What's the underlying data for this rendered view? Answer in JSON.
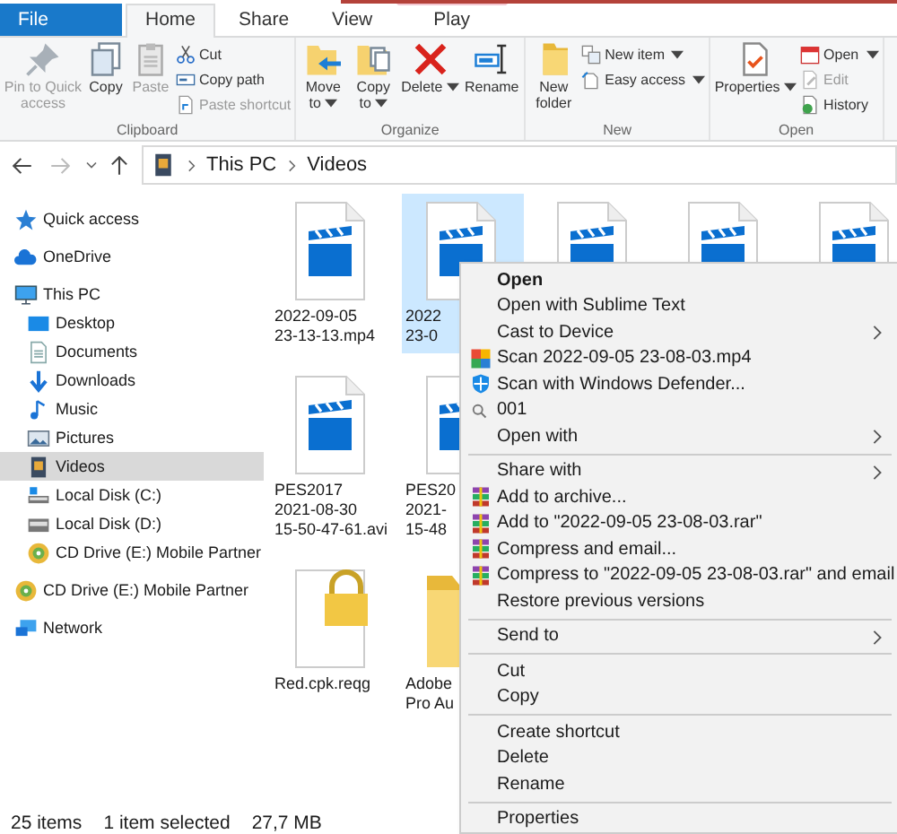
{
  "tabs": [
    {
      "label": "File",
      "kind": "file",
      "selected": false
    },
    {
      "label": "Home",
      "kind": "tab",
      "selected": true
    },
    {
      "label": "Share",
      "kind": "tab",
      "selected": false
    },
    {
      "label": "View",
      "kind": "tab",
      "selected": false
    },
    {
      "label": "Play",
      "kind": "contextual",
      "selected": false
    }
  ],
  "ribbon": {
    "groups": [
      {
        "label": "Clipboard",
        "large": [
          {
            "label": "Pin to Quick access",
            "disabled": true,
            "dropdown": false
          },
          {
            "label": "Copy",
            "disabled": false,
            "dropdown": false
          },
          {
            "label": "Paste",
            "disabled": true,
            "dropdown": false
          }
        ],
        "small": [
          {
            "label": "Cut",
            "disabled": false,
            "dropdown": false
          },
          {
            "label": "Copy path",
            "disabled": false,
            "dropdown": false
          },
          {
            "label": "Paste shortcut",
            "disabled": true,
            "dropdown": false
          }
        ]
      },
      {
        "label": "Organize",
        "large": [
          {
            "label": "Move to",
            "disabled": false,
            "dropdown": true
          },
          {
            "label": "Copy to",
            "disabled": false,
            "dropdown": true
          },
          {
            "label": "Delete",
            "disabled": false,
            "dropdown": true
          },
          {
            "label": "Rename",
            "disabled": false,
            "dropdown": false
          }
        ]
      },
      {
        "label": "New",
        "large": [
          {
            "label": "New folder",
            "disabled": false,
            "dropdown": false
          }
        ],
        "small": [
          {
            "label": "New item",
            "disabled": false,
            "dropdown": true
          },
          {
            "label": "Easy access",
            "disabled": false,
            "dropdown": true
          }
        ]
      },
      {
        "label": "Open",
        "large": [
          {
            "label": "Properties",
            "disabled": false,
            "dropdown": true
          }
        ],
        "small": [
          {
            "label": "Open",
            "disabled": false,
            "dropdown": true
          },
          {
            "label": "Edit",
            "disabled": true,
            "dropdown": false
          },
          {
            "label": "History",
            "disabled": false,
            "dropdown": false
          }
        ]
      }
    ]
  },
  "nav": {
    "back_disabled": false,
    "forward_disabled": true
  },
  "address": {
    "path": [
      "This PC",
      "Videos"
    ]
  },
  "sidebar": {
    "items": [
      {
        "label": "Quick access",
        "selected": false
      },
      {
        "label": "OneDrive",
        "selected": false
      },
      {
        "label": "This PC",
        "selected": false,
        "children": [
          {
            "label": "Desktop",
            "selected": false
          },
          {
            "label": "Documents",
            "selected": false
          },
          {
            "label": "Downloads",
            "selected": false
          },
          {
            "label": "Music",
            "selected": false
          },
          {
            "label": "Pictures",
            "selected": false
          },
          {
            "label": "Videos",
            "selected": true
          },
          {
            "label": "Local Disk (C:)",
            "selected": false
          },
          {
            "label": "Local Disk (D:)",
            "selected": false
          },
          {
            "label": "CD Drive (E:) Mobile Partner",
            "selected": false
          }
        ]
      },
      {
        "label": "CD Drive (E:) Mobile Partner",
        "selected": false
      },
      {
        "label": "Network",
        "selected": false
      }
    ]
  },
  "files": {
    "rows": [
      [
        {
          "kind": "video",
          "selected": false,
          "lines": [
            "2022-09-05",
            "23-13-13.mp4"
          ]
        },
        {
          "kind": "video",
          "selected": true,
          "lines": [
            "2022",
            "23-0"
          ]
        },
        {
          "kind": "video",
          "selected": false
        },
        {
          "kind": "video",
          "selected": false
        },
        {
          "kind": "video",
          "selected": false
        }
      ],
      [
        {
          "kind": "video",
          "selected": false,
          "lines": [
            "PES2017",
            "2021-08-30",
            "15-50-47-61.avi"
          ]
        },
        {
          "kind": "video",
          "selected": false,
          "lines": [
            "PES20",
            "2021-",
            "15-48"
          ]
        }
      ],
      [
        {
          "kind": "locked",
          "selected": false,
          "lines": [
            "Red.cpk.reqg"
          ]
        },
        {
          "kind": "folder",
          "selected": false,
          "lines": [
            "Adobe",
            "Pro Au"
          ]
        }
      ]
    ]
  },
  "context_menu": {
    "items": [
      {
        "kind": "item",
        "label": "Open",
        "default": true,
        "submenu": false
      },
      {
        "kind": "item",
        "label": "Open with Sublime Text",
        "default": false,
        "submenu": false
      },
      {
        "kind": "item",
        "label": "Cast to Device",
        "default": false,
        "submenu": true
      },
      {
        "kind": "scan",
        "label": "Scan 2022-09-05 23-08-03.mp4",
        "default": false,
        "submenu": false
      },
      {
        "kind": "shield",
        "label": "Scan with Windows Defender...",
        "default": false,
        "submenu": false
      },
      {
        "kind": "search",
        "label": "001",
        "default": false,
        "submenu": false
      },
      {
        "kind": "item",
        "label": "Open with",
        "default": false,
        "submenu": true
      },
      {
        "kind": "separator"
      },
      {
        "kind": "item",
        "label": "Share with",
        "default": false,
        "submenu": true
      },
      {
        "kind": "archive",
        "label": "Add to archive...",
        "default": false,
        "submenu": false
      },
      {
        "kind": "archive",
        "label": "Add to \"2022-09-05 23-08-03.rar\"",
        "default": false,
        "submenu": false
      },
      {
        "kind": "archive",
        "label": "Compress and email...",
        "default": false,
        "submenu": false
      },
      {
        "kind": "archive",
        "label": "Compress to \"2022-09-05 23-08-03.rar\" and email",
        "default": false,
        "submenu": false
      },
      {
        "kind": "item",
        "label": "Restore previous versions",
        "default": false,
        "submenu": false
      },
      {
        "kind": "separator"
      },
      {
        "kind": "item",
        "label": "Send to",
        "default": false,
        "submenu": true
      },
      {
        "kind": "separator"
      },
      {
        "kind": "item",
        "label": "Cut",
        "default": false,
        "submenu": false
      },
      {
        "kind": "item",
        "label": "Copy",
        "default": false,
        "submenu": false
      },
      {
        "kind": "separator"
      },
      {
        "kind": "item",
        "label": "Create shortcut",
        "default": false,
        "submenu": false
      },
      {
        "kind": "item",
        "label": "Delete",
        "default": false,
        "submenu": false
      },
      {
        "kind": "item",
        "label": "Rename",
        "default": false,
        "submenu": false
      },
      {
        "kind": "separator"
      },
      {
        "kind": "item",
        "label": "Properties",
        "default": false,
        "submenu": false
      }
    ]
  },
  "status_bar": {
    "count": "25 items",
    "selection": "1 item selected",
    "size": "27,7 MB"
  }
}
